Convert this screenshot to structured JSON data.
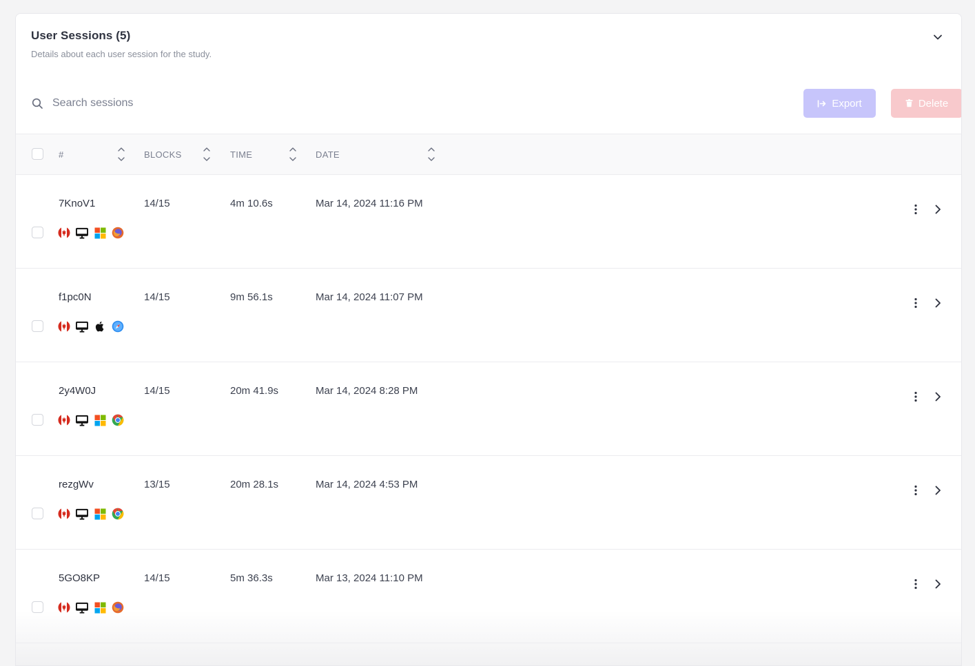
{
  "header": {
    "title": "User Sessions (5)",
    "subtitle": "Details about each user session for the study."
  },
  "toolbar": {
    "search_placeholder": "Search sessions",
    "export_label": "Export",
    "delete_label": "Delete",
    "export_color": "#c7c5fb",
    "delete_color": "#f8c9cc"
  },
  "table": {
    "columns": [
      "#",
      "BLOCKS",
      "TIME",
      "DATE"
    ],
    "rows": [
      {
        "id": "7KnoV1",
        "blocks": "14/15",
        "time": "4m 10.6s",
        "date": "Mar 14, 2024 11:16 PM",
        "country": "canada-flag-icon",
        "device": "desktop-icon",
        "os": "windows-icon",
        "browser": "firefox-icon"
      },
      {
        "id": "f1pc0N",
        "blocks": "14/15",
        "time": "9m 56.1s",
        "date": "Mar 14, 2024 11:07 PM",
        "country": "canada-flag-icon",
        "device": "desktop-icon",
        "os": "apple-icon",
        "browser": "safari-icon"
      },
      {
        "id": "2y4W0J",
        "blocks": "14/15",
        "time": "20m 41.9s",
        "date": "Mar 14, 2024 8:28 PM",
        "country": "canada-flag-icon",
        "device": "desktop-icon",
        "os": "windows-icon",
        "browser": "chrome-icon"
      },
      {
        "id": "rezgWv",
        "blocks": "13/15",
        "time": "20m 28.1s",
        "date": "Mar 14, 2024 4:53 PM",
        "country": "canada-flag-icon",
        "device": "desktop-icon",
        "os": "windows-icon",
        "browser": "chrome-icon"
      },
      {
        "id": "5GO8KP",
        "blocks": "14/15",
        "time": "5m 36.3s",
        "date": "Mar 13, 2024 11:10 PM",
        "country": "canada-flag-icon",
        "device": "desktop-icon",
        "os": "windows-icon",
        "browser": "firefox-icon"
      }
    ]
  }
}
